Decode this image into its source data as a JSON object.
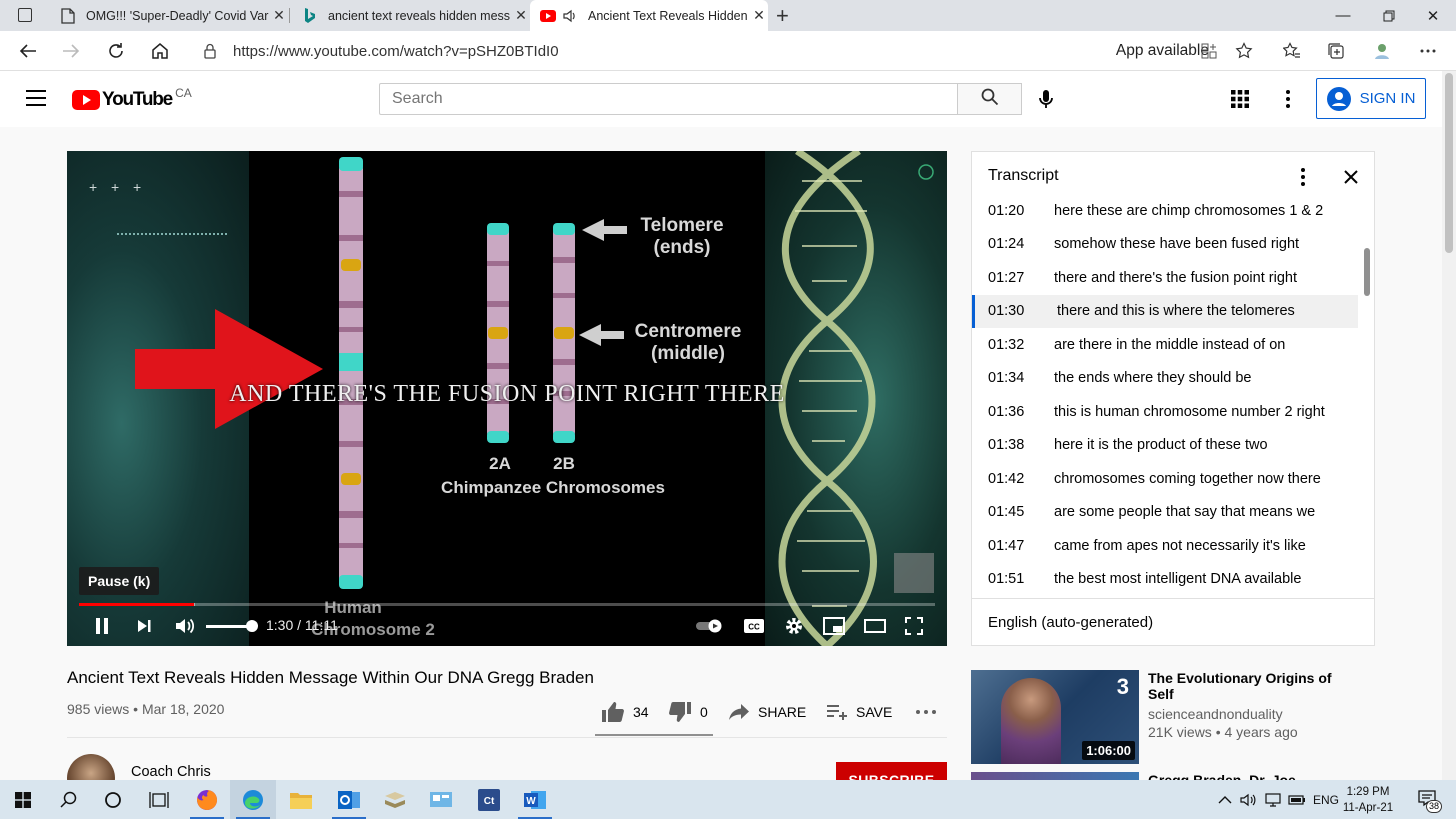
{
  "browser": {
    "tabs": [
      {
        "title": "OMG!!! 'Super-Deadly' Covid Var",
        "active": false
      },
      {
        "title": "ancient text reveals hidden mess",
        "active": false
      },
      {
        "title": "Ancient Text Reveals Hidden",
        "active": true
      }
    ],
    "url": "https://www.youtube.com/watch?v=pSHZ0BTIdI0",
    "app_available": "App available"
  },
  "masthead": {
    "logo_text": "YouTube",
    "country": "CA",
    "search_placeholder": "Search",
    "sign_in": "SIGN IN"
  },
  "player": {
    "caption": "AND THERE'S THE FUSION POINT RIGHT THERE",
    "frame_labels": {
      "telomere": "Telomere",
      "telomere_sub": "(ends)",
      "centromere": "Centromere",
      "centromere_sub": "(middle)",
      "a2": "2A",
      "b2": "2B",
      "chimp": "Chimpanzee Chromosomes",
      "human": "Human",
      "human_sub": "Chromosome 2"
    },
    "tooltip": "Pause (k)",
    "time_current": "1:30",
    "time_total": "11:11",
    "progress": 0.134,
    "buffered": 0.135,
    "volume": 1.0
  },
  "video": {
    "title": "Ancient Text Reveals Hidden Message Within Our DNA Gregg Braden",
    "views": "985 views",
    "date": "Mar 18, 2020",
    "likes": "34",
    "dislikes": "0",
    "share": "SHARE",
    "save": "SAVE",
    "channel": "Coach Chris",
    "subscribe": "SUBSCRIBE"
  },
  "transcript": {
    "title": "Transcript",
    "language": "English (auto-generated)",
    "lines": [
      {
        "time": "01:20",
        "text": "here these are chimp chromosomes 1 & 2"
      },
      {
        "time": "01:24",
        "text": "somehow these have been fused right"
      },
      {
        "time": "01:27",
        "text": "there and there's the fusion point right"
      },
      {
        "time": "01:30",
        "text": "there and this is where the telomeres",
        "current": true
      },
      {
        "time": "01:32",
        "text": "are there in the middle instead of on"
      },
      {
        "time": "01:34",
        "text": "the ends where they should be"
      },
      {
        "time": "01:36",
        "text": "this is human chromosome number 2 right"
      },
      {
        "time": "01:38",
        "text": "here it is the product of these two"
      },
      {
        "time": "01:42",
        "text": "chromosomes coming together now there"
      },
      {
        "time": "01:45",
        "text": "are some people that say that means we"
      },
      {
        "time": "01:47",
        "text": "came from apes not necessarily it's like"
      },
      {
        "time": "01:51",
        "text": "the best most intelligent DNA available"
      }
    ]
  },
  "recommendations": [
    {
      "title": "The Evolutionary Origins of Self",
      "channel": "scienceandnonduality",
      "views": "21K views",
      "age": "4 years ago",
      "duration": "1:06:00"
    },
    {
      "title": "Gregg Braden, Dr. Joe"
    }
  ],
  "taskbar": {
    "language": "ENG",
    "time": "1:29 PM",
    "date": "11-Apr-21",
    "notifications": "38"
  },
  "colors": {
    "youtube_red": "#ff0000",
    "accent_blue": "#065fd4",
    "subscribe_red": "#cc0000"
  }
}
